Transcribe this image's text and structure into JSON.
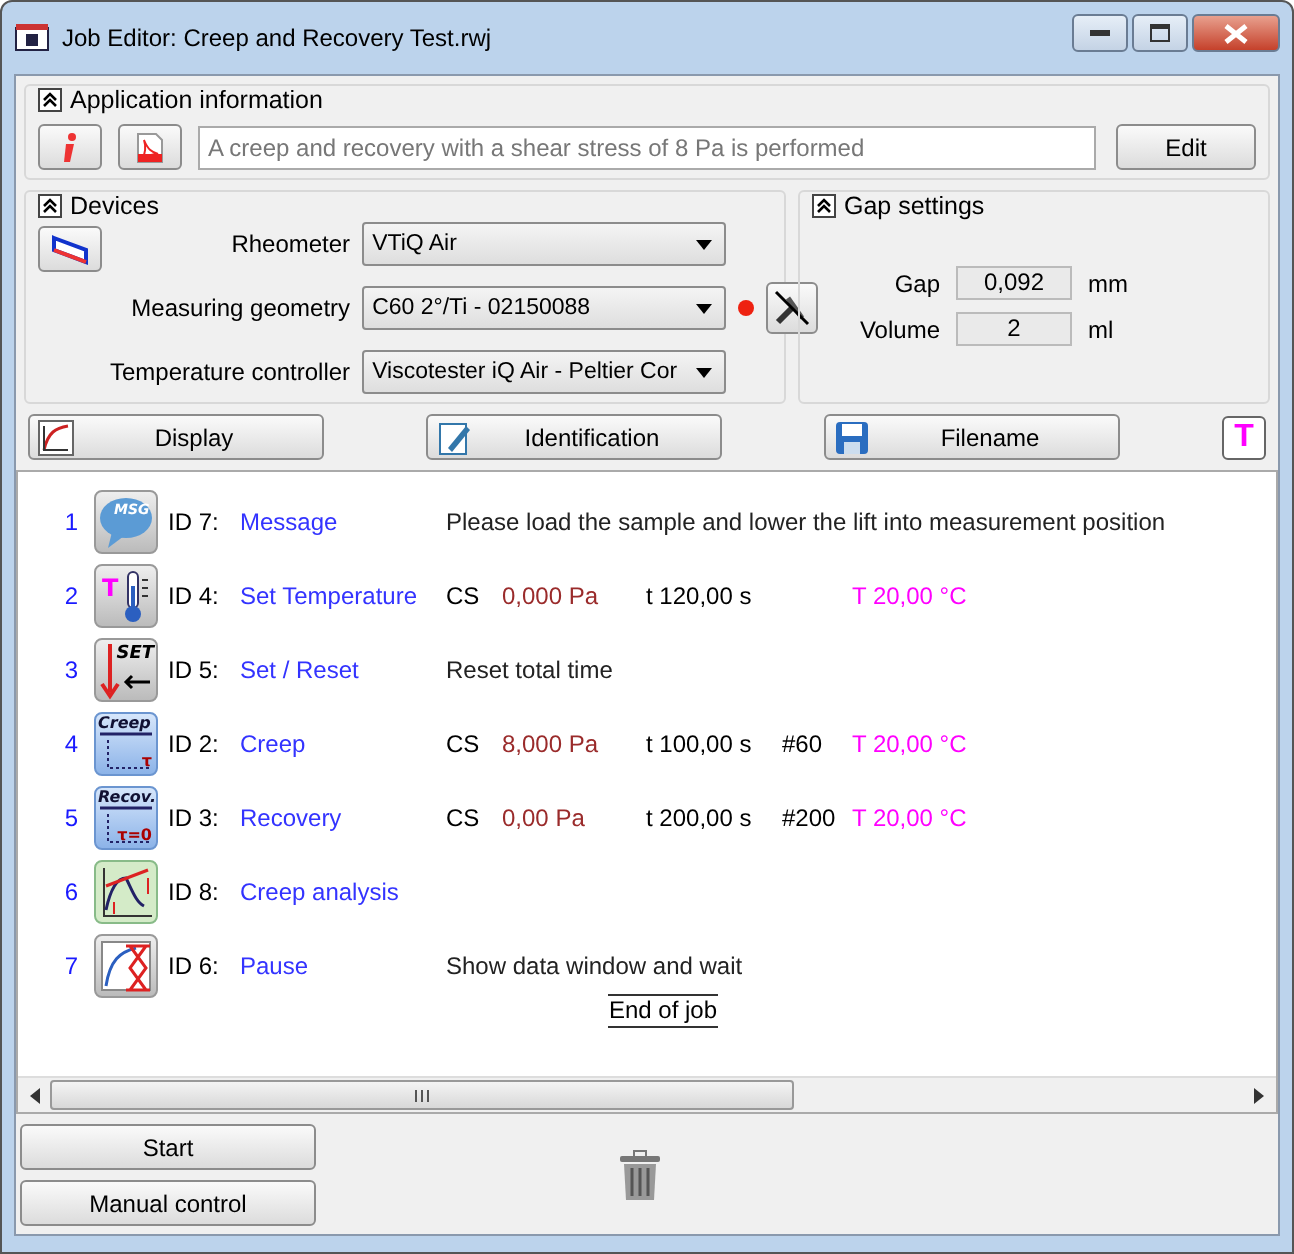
{
  "window": {
    "title": "Job Editor: Creep and Recovery Test.rwj"
  },
  "application_information": {
    "label": "Application information",
    "expanded": true,
    "description": "A creep and recovery with a shear stress of 8 Pa is performed",
    "edit_button": "Edit"
  },
  "devices": {
    "label": "Devices",
    "expanded": true,
    "fields": [
      {
        "label": "Rheometer",
        "value": "VTiQ Air",
        "status_dot": false,
        "tool_button": false
      },
      {
        "label": "Measuring geometry",
        "value": "C60 2°/Ti - 02150088",
        "status_dot": true,
        "tool_button": true
      },
      {
        "label": "Temperature controller",
        "value": "Viscotester iQ Air - Peltier Cor",
        "status_dot": false,
        "tool_button": false
      }
    ]
  },
  "gap_settings": {
    "label": "Gap settings",
    "expanded": true,
    "fields": [
      {
        "label": "Gap",
        "value": "0,092",
        "unit": "mm"
      },
      {
        "label": "Volume",
        "value": "2",
        "unit": "ml"
      }
    ]
  },
  "toolbar": {
    "buttons": [
      {
        "label": "Display"
      },
      {
        "label": "Identification"
      },
      {
        "label": "Filename"
      }
    ],
    "temperature_button": "T"
  },
  "steps": [
    {
      "number": "1",
      "kind": "msg",
      "icon_text": [
        "MSG"
      ],
      "id": "ID 7:",
      "name": "Message",
      "description": "Please load the sample and lower the lift into measurement position"
    },
    {
      "number": "2",
      "kind": "temp",
      "icon_text": [
        "T"
      ],
      "id": "ID 4:",
      "name": "Set Temperature",
      "params": {
        "mode": "CS",
        "stress": "0,000 Pa",
        "time": "t 120,00 s",
        "temperature": "T 20,00 °C"
      }
    },
    {
      "number": "3",
      "kind": "set",
      "icon_text": [
        "SET"
      ],
      "id": "ID 5:",
      "name": "Set / Reset",
      "description": "Reset total time"
    },
    {
      "number": "4",
      "kind": "creep",
      "icon_text": [
        "Creep",
        "τ"
      ],
      "id": "ID 2:",
      "name": "Creep",
      "params": {
        "mode": "CS",
        "stress": "8,000 Pa",
        "time": "t 100,00 s",
        "points": "#60",
        "temperature": "T 20,00 °C"
      }
    },
    {
      "number": "5",
      "kind": "recov",
      "icon_text": [
        "Recov.",
        "τ=0"
      ],
      "id": "ID 3:",
      "name": "Recovery",
      "params": {
        "mode": "CS",
        "stress": "0,00 Pa",
        "time": "t 200,00 s",
        "points": "#200",
        "temperature": "T 20,00 °C"
      }
    },
    {
      "number": "6",
      "kind": "analysis",
      "id": "ID 8:",
      "name": "Creep analysis"
    },
    {
      "number": "7",
      "kind": "pause",
      "id": "ID 6:",
      "name": "Pause",
      "description": "Show data window and wait"
    }
  ],
  "end_marker": "End of job",
  "bottom_buttons": [
    "Start",
    "Manual control"
  ]
}
